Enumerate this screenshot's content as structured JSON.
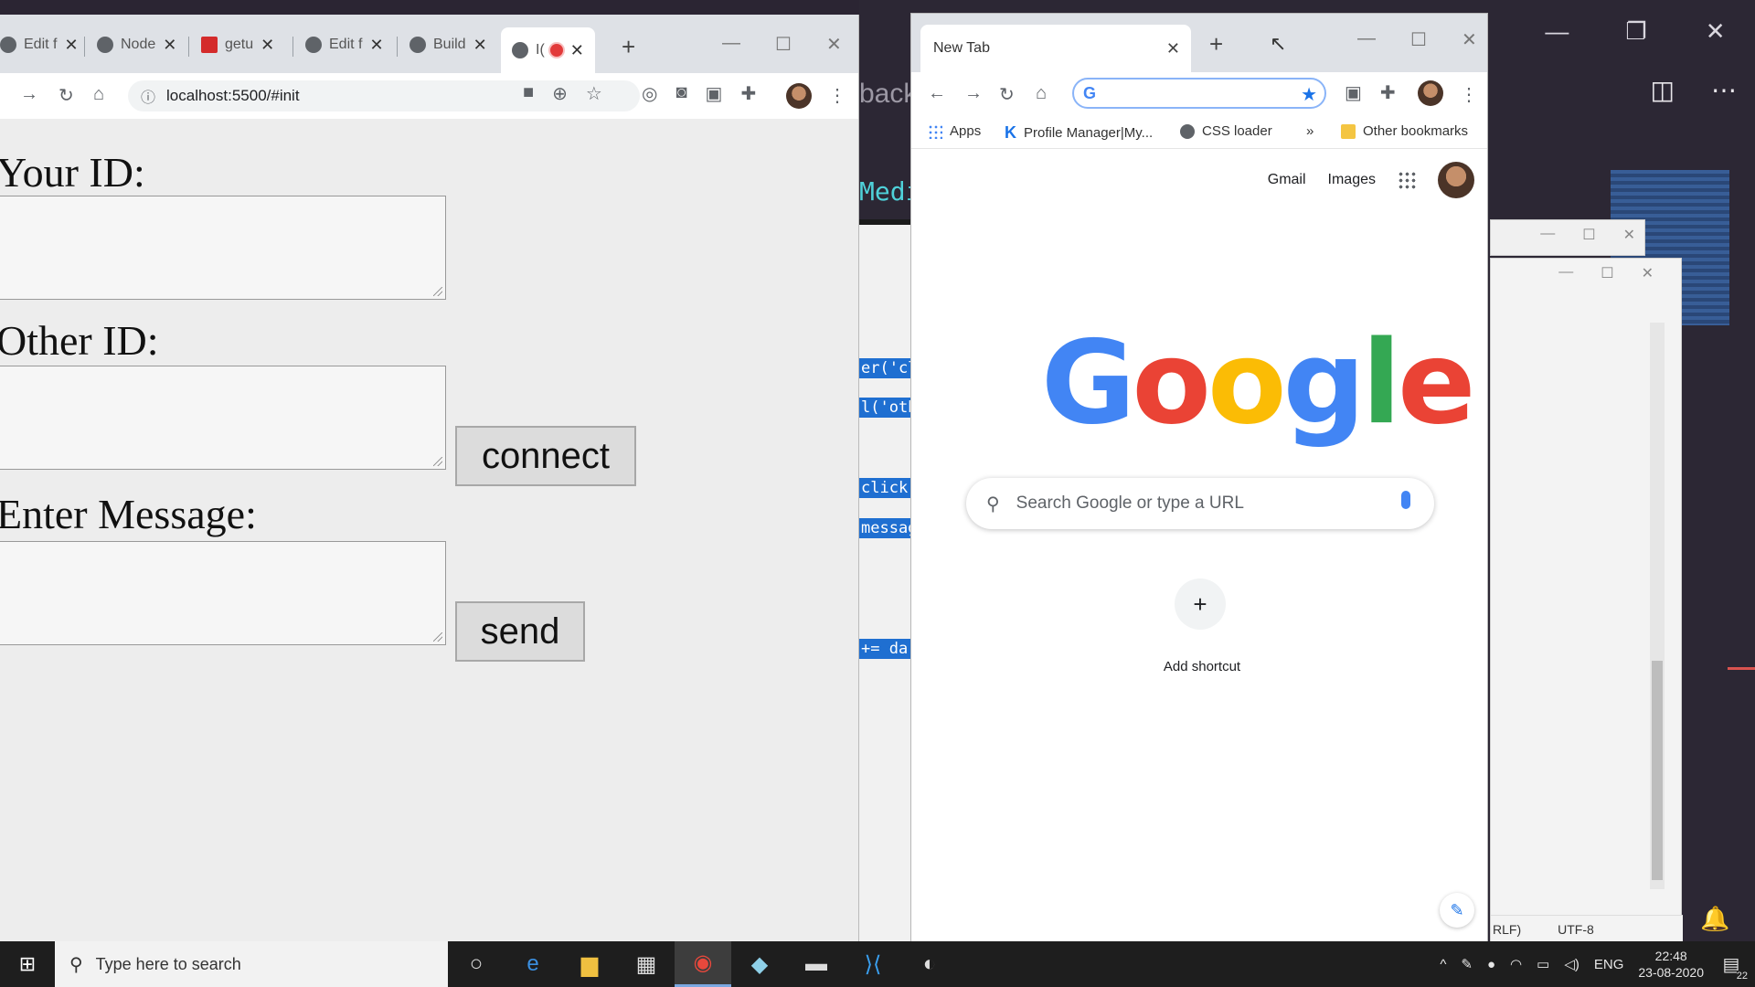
{
  "background": {
    "partial_text_back": "back",
    "partial_text_medi": "Medi",
    "code_chips": [
      "er('cl",
      "l('oth",
      "click",
      "messag",
      "+= da"
    ],
    "status_items": [
      "RLF)",
      "UTF-8"
    ]
  },
  "left_browser": {
    "tabs": [
      {
        "label": "Edit f"
      },
      {
        "label": "Node"
      },
      {
        "label": "getu"
      },
      {
        "label": "Edit f"
      },
      {
        "label": "Build"
      },
      {
        "label": "I("
      }
    ],
    "url": "localhost:5500/#init",
    "form": {
      "your_id_label": "Your ID:",
      "other_id_label": "Other ID:",
      "message_label": "Enter Message:",
      "connect_button": "connect",
      "send_button": "send"
    }
  },
  "right_browser": {
    "tab_title": "New Tab",
    "bookmarks": {
      "apps": "Apps",
      "profile_manager": "Profile Manager|My...",
      "css_loader": "CSS loader",
      "more": "»",
      "other": "Other bookmarks"
    },
    "links": {
      "gmail": "Gmail",
      "images": "Images"
    },
    "search_placeholder": "Search Google or type a URL",
    "add_shortcut_label": "Add shortcut"
  },
  "taskbar": {
    "search_placeholder": "Type here to search",
    "language": "ENG",
    "time": "22:48",
    "date": "23-08-2020",
    "notification_count": "22"
  }
}
